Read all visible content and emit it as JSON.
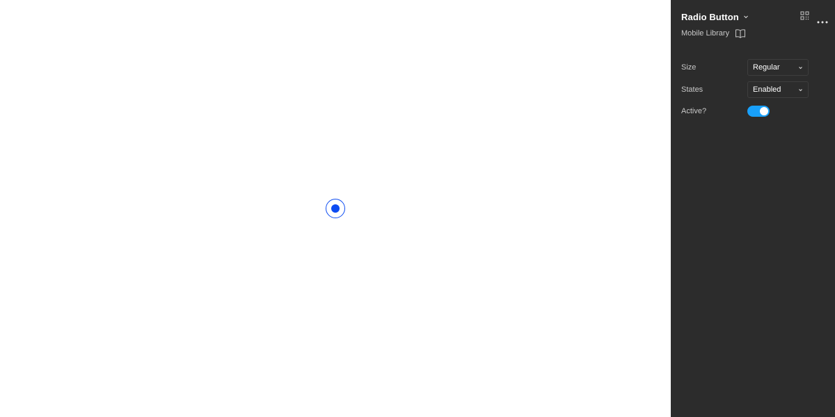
{
  "canvas": {
    "radio": {
      "state": "selected",
      "color": "#0d4cf2"
    }
  },
  "panel": {
    "title": "Radio Button",
    "title_chevron_icon": "chevron-down-icon",
    "actions": {
      "grid_icon": "component-grid-icon",
      "more_icon": "more-horizontal-icon"
    },
    "library": {
      "name": "Mobile Library",
      "icon": "book-icon"
    },
    "properties": [
      {
        "label": "Size",
        "type": "select",
        "value": "Regular"
      },
      {
        "label": "States",
        "type": "select",
        "value": "Enabled"
      },
      {
        "label": "Active?",
        "type": "toggle",
        "value": true
      }
    ],
    "colors": {
      "background": "#2c2c2c",
      "toggle_on": "#18a0fb"
    }
  }
}
